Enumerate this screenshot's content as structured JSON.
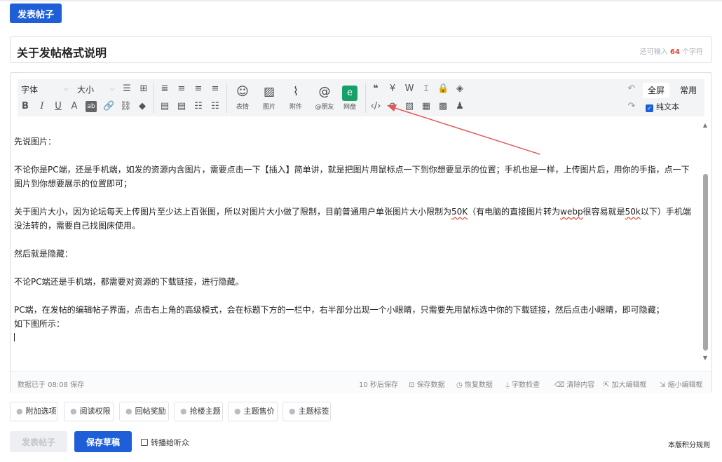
{
  "top": {
    "post_button": "发表帖子"
  },
  "title_input": {
    "value": "关于发帖格式说明",
    "counter_prefix": "还可输入",
    "counter_num": "64",
    "counter_suffix": "个字符"
  },
  "toolbar": {
    "font_select": "字体",
    "size_select": "大小",
    "insert": [
      {
        "label": "表情",
        "icon": "smile-icon"
      },
      {
        "label": "图片",
        "icon": "image-icon"
      },
      {
        "label": "附件",
        "icon": "paperclip-icon"
      },
      {
        "label": "@朋友",
        "icon": "at-icon"
      },
      {
        "label": "网盘",
        "icon": "netdisk-icon"
      }
    ],
    "mode_full": "全屏",
    "mode_common": "常用",
    "plain_text": "纯文本"
  },
  "content": {
    "lines": [
      "先说图片：",
      "",
      "不论你是PC端，还是手机端，如发的资源内含图片，需要点击一下【插入】简单讲，就是把图片用鼠标点一下到你想要显示的位置；手机也是一样，上传图片后，用你的手指，点一下图片到你想要展示的位置即可；",
      "",
      "关于图片大小，因为论坛每天上传图片至少达上百张图，所以对图片大小做了限制，目前普通用户单张图片大小限制为50K（有电脑的直接图片转为webp很容易就是50k以下）手机端没法转的，需要自己找图床使用。",
      "",
      "然后就是隐藏：",
      "",
      "不论PC端还是手机端，都需要对资源的下载链接，进行隐藏。",
      "",
      "PC端，在发帖的编辑帖子界面，点击右上角的高级模式，会在标题下方的一栏中，右半部分出现一个小眼睛，只需要先用鼠标选中你的下载链接，然后点击小眼睛，即可隐藏；",
      "如下图所示："
    ]
  },
  "status": {
    "saved": "数据已于 08:08 保存",
    "autosave": "10 秒后保存",
    "save_data": "保存数据",
    "restore_data": "恢复数据",
    "word_check": "字数检查",
    "clear_content": "清除内容",
    "enlarge": "加大编辑框",
    "shrink": "缩小编辑框"
  },
  "options": [
    "附加选项",
    "阅读权限",
    "回帖奖励",
    "抢楼主题",
    "主题售价",
    "主题标签"
  ],
  "bottom": {
    "post_button": "发表帖子",
    "draft_button": "保存草稿",
    "listen_checkbox": "转播给听众",
    "rules_link": "本版积分规则"
  },
  "colors": {
    "primary": "#1e5fd8",
    "counter": "#e0442c",
    "annotation_arrow": "#e05a5a"
  }
}
